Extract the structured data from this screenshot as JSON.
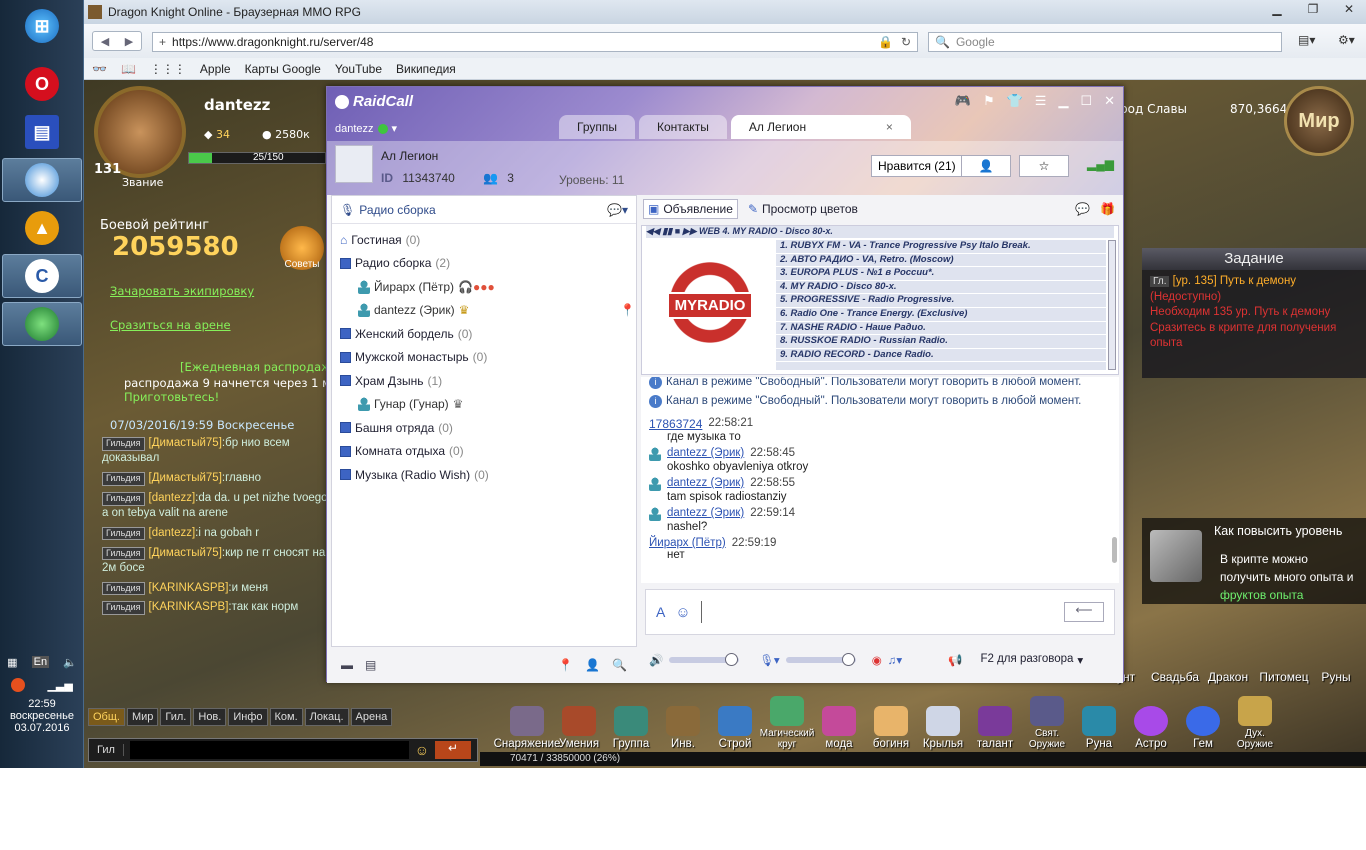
{
  "taskbar": {
    "clock": "22:59",
    "day": "воскресенье",
    "date": "03.07.2016",
    "lang": "En"
  },
  "browser": {
    "title": "Dragon Knight Online - Браузерная MMO RPG",
    "url": "https://www.dragonknight.ru/server/48",
    "search_placeholder": "Google",
    "bookmarks": [
      "Apple",
      "Карты Google",
      "YouTube",
      "Википедия"
    ]
  },
  "game": {
    "player_name": "dantezz",
    "level": "131",
    "rank_label": "Звание",
    "gems": "34",
    "gold": "2580к",
    "hp": "25/150",
    "rating_label": "Боевой рейтинг",
    "rating": "2059580",
    "tips_label": "Советы",
    "coords_label": "род Славы",
    "coords": "870,3664",
    "world_button": "Мир",
    "links": [
      "Зачаровать экипировку",
      "Сразиться на арене"
    ],
    "event_lines": [
      "[Ежедневная распродаж",
      "распродажа 9 начнется через 1 ми",
      "Приготовьтесь!"
    ],
    "chat_timestamp": "07/03/2016/19:59 Воскресенье",
    "guild_tag": "Гильдия",
    "chat": [
      {
        "who": "[Димастый75]",
        "text": ":бр нио всем доказывал"
      },
      {
        "who": "[Димастый75]",
        "text": ":главно"
      },
      {
        "who": "[dantezz]",
        "text": ":da da. u pet nizhe tvoego a on tebya valit na arene"
      },
      {
        "who": "[dantezz]",
        "text": ":i na gobah r"
      },
      {
        "who": "[Димастый75]",
        "text": ":кир пе гг сносят на 2м босе"
      },
      {
        "who": "[KARINKASPB]",
        "text": ":и меня"
      },
      {
        "who": "[KARINKASPB]",
        "text": ":так как норм"
      }
    ],
    "chat_tabs": [
      "Общ.",
      "Мир",
      "Гил.",
      "Нов.",
      "Инфо",
      "Ком.",
      "Локац.",
      "Арена"
    ],
    "chat_input_label": "Гил",
    "bottom_menu": [
      "Снаряжение",
      "Умения",
      "Группа",
      "Инв.",
      "Строй",
      "Магический круг",
      "мода",
      "богиня",
      "Крылья",
      "талант",
      "Свят. Оружие",
      "Руна",
      "Астро",
      "Гем",
      "Дух. Оружие"
    ],
    "top_menu": [
      "унт",
      "Свадьба",
      "Дракон",
      "Питомец",
      "Руны"
    ],
    "xp": "70471 / 33850000 (26%)",
    "quest_title": "Задание",
    "quest_tag": "Гл.",
    "quest_lines": [
      "[ур. 135] Путь к демону",
      "(Недоступно)",
      "Необходим 135 ур. Путь к демону",
      "Сразитесь в крипте для получения опыта"
    ],
    "howto_title": "Как повысить уровень",
    "howto_text": [
      "В крипте можно",
      "получить много опыта и",
      "фруктов опыта"
    ]
  },
  "raidcall": {
    "brand": "RaidCall",
    "user": "dantezz",
    "tabs": [
      "Группы",
      "Контакты",
      "Ал Легион"
    ],
    "channel_name": "Ал Легион",
    "id_label": "ID",
    "channel_id": "11343740",
    "members": "3",
    "level_label": "Уровень: 11",
    "like_button": "Нравится (21)",
    "room_header": "Радио сборка",
    "rooms": [
      {
        "name": "Гостиная",
        "count": "(0)"
      },
      {
        "name": "Радио сборка",
        "count": "(2)"
      },
      {
        "name": "Женский бордель",
        "count": "(0)"
      },
      {
        "name": "Мужской монастырь",
        "count": "(0)"
      },
      {
        "name": "Храм Дзынь",
        "count": "(1)"
      },
      {
        "name": "Башня отряда",
        "count": "(0)"
      },
      {
        "name": "Комната отдыха",
        "count": "(0)"
      },
      {
        "name": "Музыка (Radio Wish)",
        "count": "(0)"
      }
    ],
    "radio_users": [
      "Йирарх (Пётр)",
      "dantezz (Эрик)"
    ],
    "temple_users": [
      "Гунар (Гунар)"
    ],
    "announce_button": "Объявление",
    "colors_button": "Просмотр цветов",
    "player_ticker": "WEB 4. MY RADIO - Disco 80-x.",
    "logo_text": "MYRADIO",
    "stations": [
      "1. RUBYX FM - VA - Trance Progressive Psy Italo Break.",
      "2. АВТО РАДИО - VA, Retro. (Moscow)",
      "3. EUROPA PLUS - №1 в России*.",
      "4. MY RADIO - Disco 80-x.",
      "5. PROGRESSIVE - Radio Progressive.",
      "6. Radio One - Trance Energy. (Exclusive)",
      "7. NASHE RADIO - Наше Радио.",
      "8. RUSSKOE RADIO - Russian Radio.",
      "9. RADIO RECORD - Dance Radio."
    ],
    "system_msg": "Канал в режиме \"Свободный\". Пользователи могут говорить в любой момент.",
    "messages": [
      {
        "user": "17863724",
        "time": "22:58:21",
        "text": "где музыка то"
      },
      {
        "user": "dantezz (Эрик)",
        "time": "22:58:45",
        "text": "okoshko obyavleniya otkroy"
      },
      {
        "user": "dantezz (Эрик)",
        "time": "22:58:55",
        "text": "tam spisok radiostanziy"
      },
      {
        "user": "dantezz (Эрик)",
        "time": "22:59:14",
        "text": "nashel?"
      },
      {
        "user": "Йирарх (Пётр)",
        "time": "22:59:19",
        "text": "нет"
      }
    ],
    "talk_mode": "F2 для разговора"
  }
}
